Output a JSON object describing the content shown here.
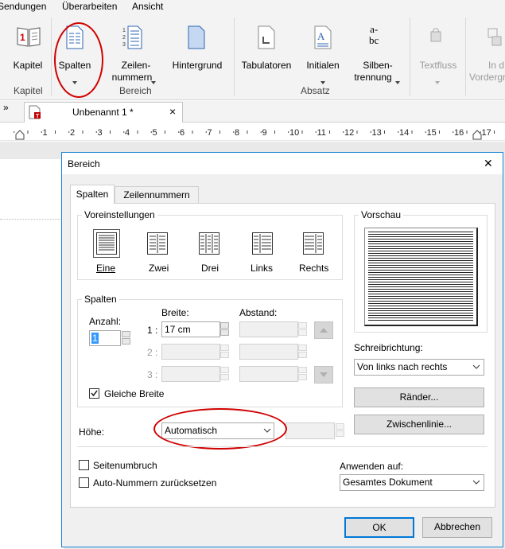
{
  "menubar": {
    "items": [
      "Sendungen",
      "Überarbeiten",
      "Ansicht"
    ]
  },
  "ribbon": {
    "buttons": {
      "kapitel": "Kapitel",
      "spalten": "Spalten",
      "zeilen1": "Zeilen-",
      "zeilen2": "nummern",
      "hintergrund": "Hintergrund",
      "tabulatoren": "Tabulatoren",
      "initialen": "Initialen",
      "silben1": "Silben-",
      "silben2": "trennung",
      "textfluss": "Textfluss",
      "in_d": "In d",
      "vordergr": "Vordergr"
    },
    "groups": {
      "kapitel": "Kapitel",
      "bereich": "Bereich",
      "absatz": "Absatz"
    }
  },
  "tabstrip": {
    "chevron": "»",
    "doc_title": "Unbenannt 1 *",
    "close": "×"
  },
  "ruler": {
    "numbers": [
      "1",
      "2",
      "3",
      "4",
      "5",
      "6",
      "7",
      "8",
      "9",
      "10",
      "11",
      "12",
      "13",
      "14",
      "15",
      "16",
      "17",
      "18"
    ]
  },
  "dialog": {
    "title": "Bereich",
    "close": "✕",
    "tabs": [
      "Spalten",
      "Zeilennummern"
    ],
    "presets": {
      "legend": "Voreinstellungen",
      "items": [
        "Eine",
        "Zwei",
        "Drei",
        "Links",
        "Rechts"
      ]
    },
    "columns": {
      "legend": "Spalten",
      "anzahl_label": "Anzahl:",
      "anzahl_value": "1",
      "breite_label": "Breite:",
      "abstand_label": "Abstand:",
      "rows": [
        "1 :",
        "2 :",
        "3 :"
      ],
      "breite1": "17 cm",
      "gleiche_breite": "Gleiche Breite"
    },
    "hoehe_label": "Höhe:",
    "hoehe_value": "Automatisch",
    "preview_legend": "Vorschau",
    "writing_dir_label": "Schreibrichtung:",
    "writing_dir_value": "Von links nach rechts",
    "raender_button": "Ränder...",
    "zwischenlinie_button": "Zwischenlinie...",
    "seitenumbruch": "Seitenumbruch",
    "auto_nummern": "Auto-Nummern zurücksetzen",
    "anwenden_label": "Anwenden auf:",
    "anwenden_value": "Gesamtes Dokument",
    "ok": "OK",
    "abbrechen": "Abbrechen"
  },
  "colors": {
    "accent": "#1883d7",
    "annotation": "#d10000"
  }
}
